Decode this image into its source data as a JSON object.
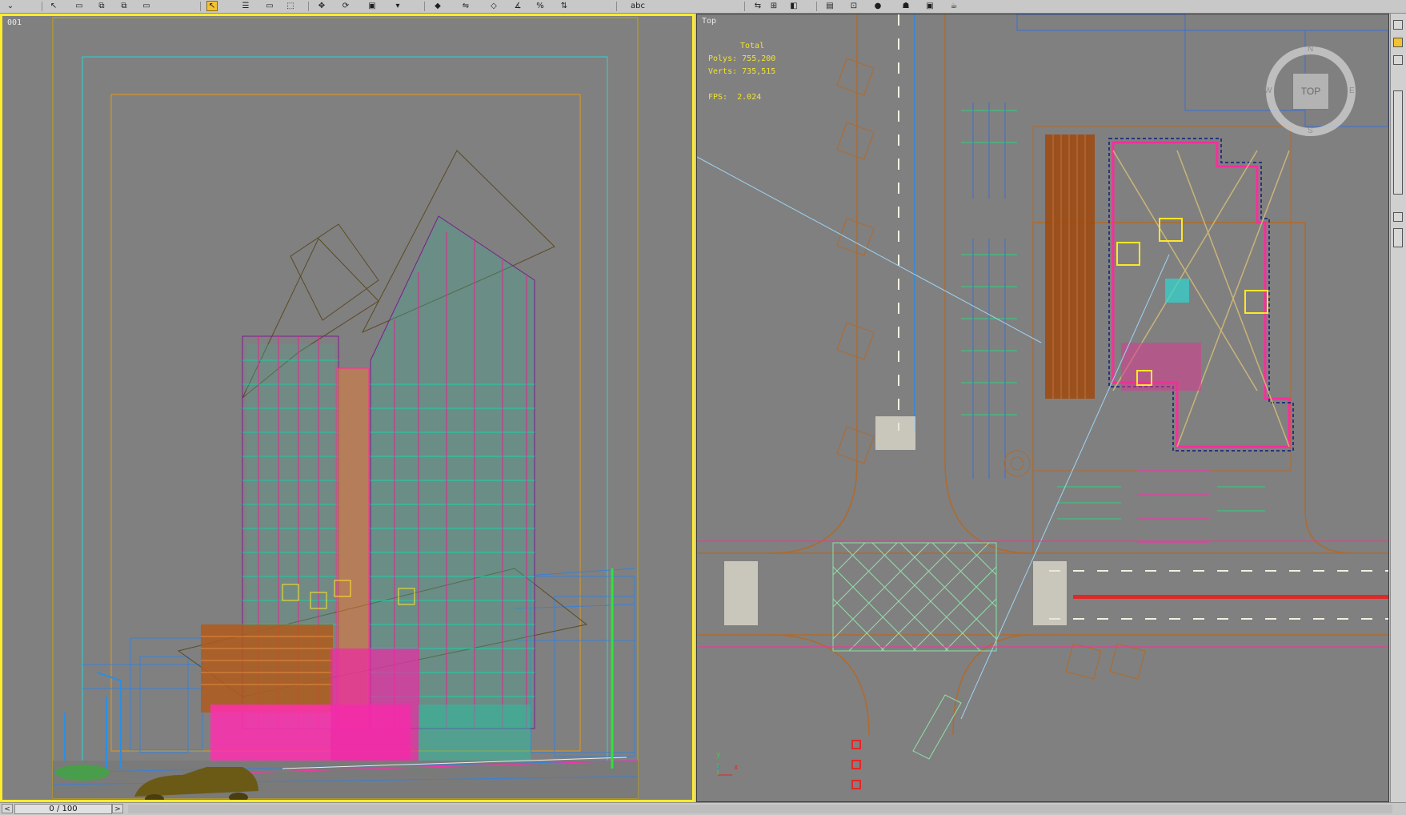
{
  "toolbar": {
    "icons": [
      {
        "name": "select-icon",
        "glyph": "⌄"
      },
      {
        "name": "select-object-icon",
        "glyph": "↖"
      },
      {
        "name": "link-icon",
        "glyph": "▭"
      },
      {
        "name": "unlink-icon",
        "glyph": "⧉"
      },
      {
        "name": "bind-icon",
        "glyph": "⧉"
      },
      {
        "name": "selection-filter-icon",
        "glyph": "▭"
      },
      {
        "name": "select-arrow-icon",
        "glyph": "↖"
      },
      {
        "name": "select-by-name-icon",
        "glyph": "☰"
      },
      {
        "name": "rect-selection-icon",
        "glyph": "▭"
      },
      {
        "name": "window-crossing-icon",
        "glyph": "⬚"
      },
      {
        "name": "move-icon",
        "glyph": "✥"
      },
      {
        "name": "rotate-icon",
        "glyph": "⟳"
      },
      {
        "name": "scale-icon",
        "glyph": "▣"
      },
      {
        "name": "reference-coord-icon",
        "glyph": "▾"
      },
      {
        "name": "pivot-icon",
        "glyph": "◆"
      },
      {
        "name": "mirror-icon",
        "glyph": "⇋"
      },
      {
        "name": "snap-icon",
        "glyph": "◇"
      },
      {
        "name": "angle-snap-icon",
        "glyph": "∡"
      },
      {
        "name": "percent-snap-icon",
        "glyph": "%"
      },
      {
        "name": "spinner-snap-icon",
        "glyph": "⇅"
      },
      {
        "name": "named-selection-icon",
        "glyph": "abc"
      },
      {
        "name": "mirror-tool-icon",
        "glyph": "⇆"
      },
      {
        "name": "align-icon",
        "glyph": "⊞"
      },
      {
        "name": "layer-icon",
        "glyph": "◧"
      },
      {
        "name": "curve-editor-icon",
        "glyph": "▤"
      },
      {
        "name": "schematic-icon",
        "glyph": "⊡"
      },
      {
        "name": "material-editor-icon",
        "glyph": "●"
      },
      {
        "name": "render-setup-icon",
        "glyph": "☗"
      },
      {
        "name": "render-frame-icon",
        "glyph": "▣"
      },
      {
        "name": "render-icon",
        "glyph": "☕"
      }
    ]
  },
  "viewports": {
    "perspective": {
      "label": "001"
    },
    "top": {
      "label": "Top",
      "stats": {
        "total_label": "Total",
        "polys_label": "Polys:",
        "polys_value": "755,200",
        "verts_label": "Verts:",
        "verts_value": "735,515",
        "fps_label": "FPS:",
        "fps_value": "2.024"
      },
      "viewcube": {
        "face": "TOP",
        "n": "N",
        "s": "S",
        "e": "E",
        "w": "W"
      },
      "axis": {
        "x": "x",
        "y": "y",
        "z": "z"
      }
    }
  },
  "timebar": {
    "frame_label": "0 / 100",
    "prev_glyph": "<",
    "next_glyph": ">"
  },
  "colors": {
    "viewport_bg": "#808080",
    "active_border": "#ffec2a",
    "stats_text": "#f2e23a"
  }
}
